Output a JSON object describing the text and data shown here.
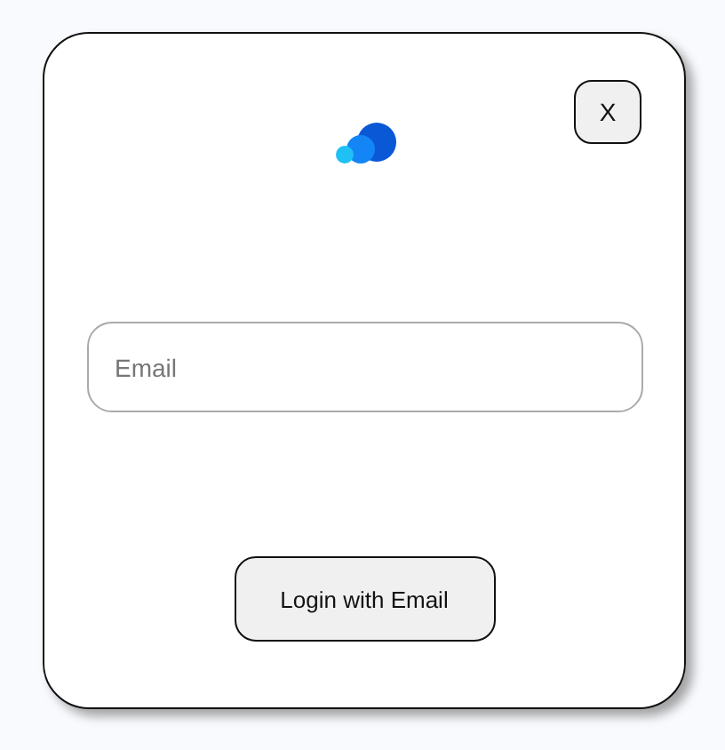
{
  "close_button": {
    "label": "X"
  },
  "email_field": {
    "placeholder": "Email"
  },
  "login_button": {
    "label": "Login with Email"
  }
}
